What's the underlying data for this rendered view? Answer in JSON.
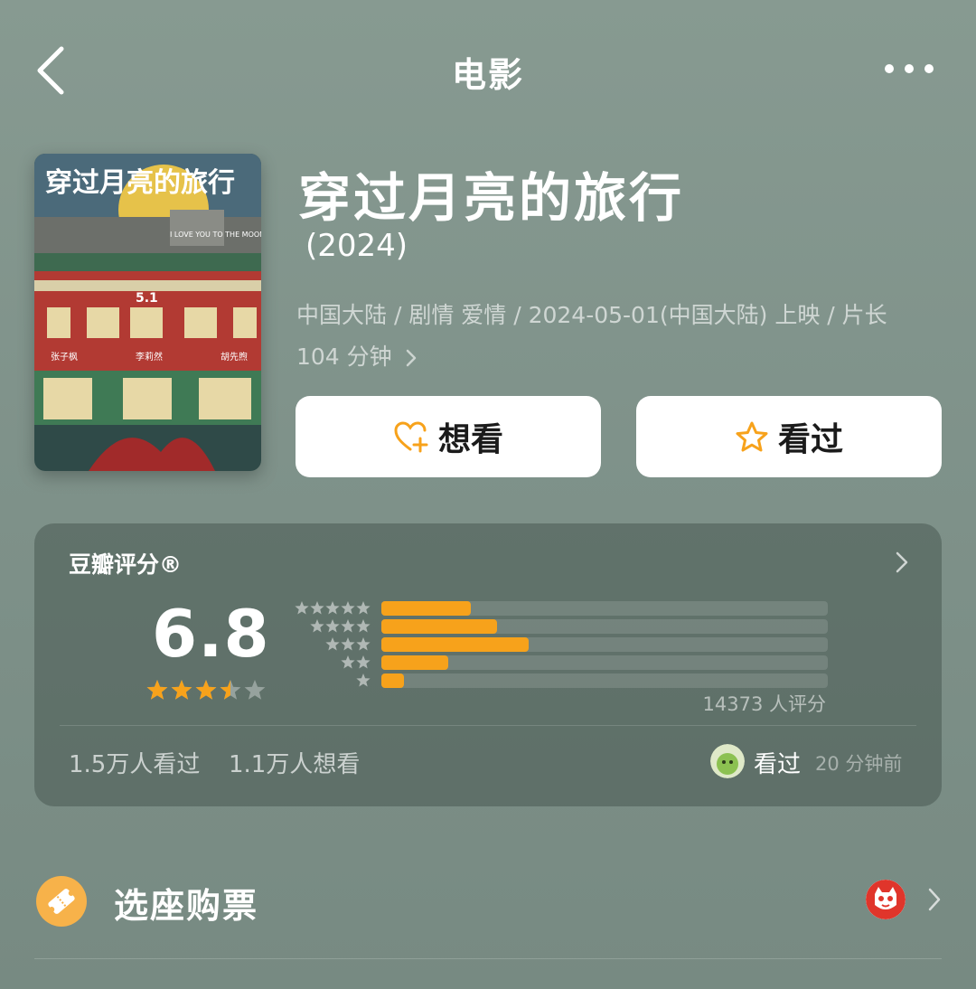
{
  "header": {
    "title": "电影",
    "back_icon": "chevron-left-icon",
    "more_icon": "more-dots-icon"
  },
  "movie": {
    "title": "穿过月亮的旅行",
    "year": "(2024)",
    "meta_line": "中国大陆 / 剧情 爱情 / 2024-05-01(中国大陆) 上映 / 片长104 分钟",
    "poster": {
      "title_text": "穿过月亮的旅行",
      "english_text": "I LOVE YOU TO THE MOON AND BACK",
      "release_text": "5.1",
      "cast": [
        "张子枫",
        "李莉然",
        "胡先煦"
      ]
    }
  },
  "actions": {
    "want_label": "想看",
    "want_icon": "heart-plus-icon",
    "seen_label": "看过",
    "seen_icon": "star-outline-icon"
  },
  "rating": {
    "label": "豆瓣评分®",
    "score": "6.8",
    "star_level": 3.5,
    "distribution": [
      {
        "stars": 5,
        "percent": 20
      },
      {
        "stars": 4,
        "percent": 26
      },
      {
        "stars": 3,
        "percent": 33
      },
      {
        "stars": 2,
        "percent": 15
      },
      {
        "stars": 1,
        "percent": 5
      }
    ],
    "count_text": "14373 人评分",
    "seen_text": "1.5万人看过",
    "want_text": "1.1万人想看",
    "friend_action": "看过",
    "friend_time": "20 分钟前"
  },
  "ticket": {
    "label": "选座购票",
    "icon": "ticket-icon",
    "provider_icon": "maoyan-cat-icon"
  },
  "colors": {
    "accent": "#f7a21b",
    "background": "#879a91"
  }
}
